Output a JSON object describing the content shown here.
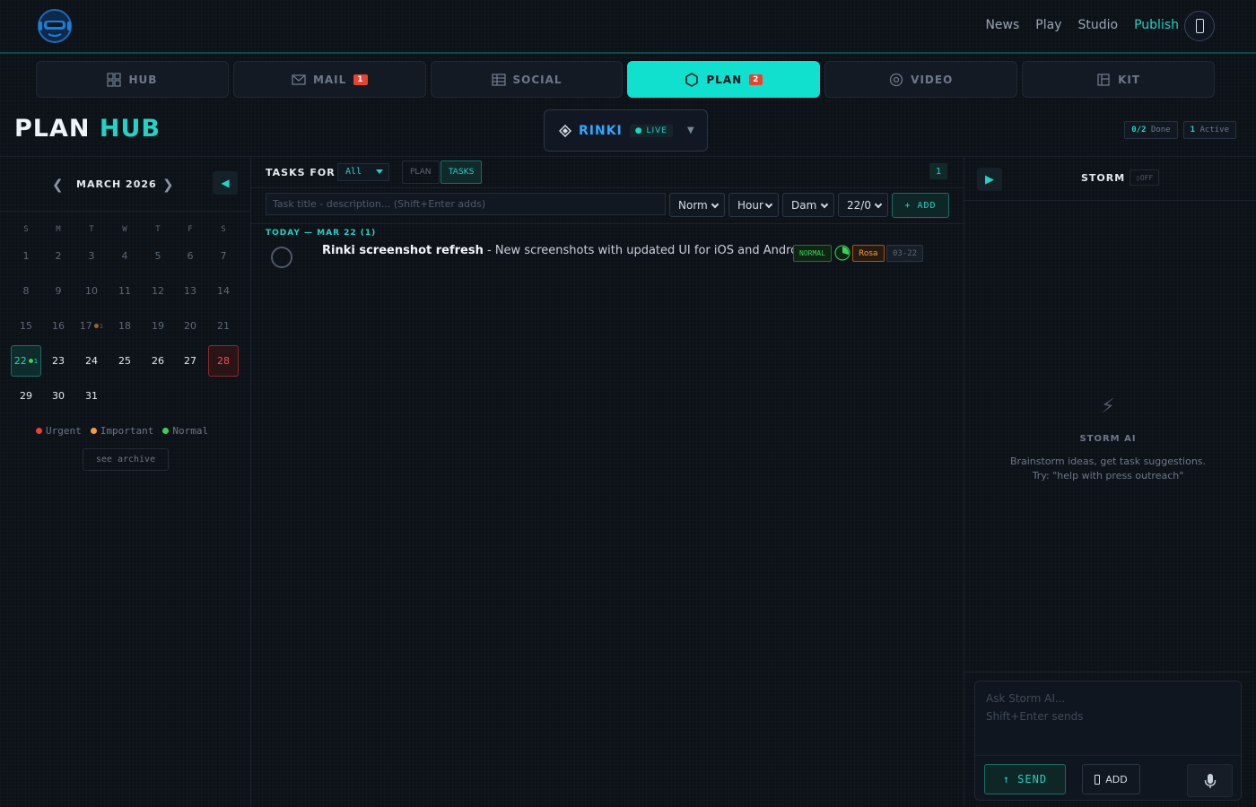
{
  "topnav": {
    "items": [
      {
        "label": "News",
        "active": false
      },
      {
        "label": "Play",
        "active": false
      },
      {
        "label": "Studio",
        "active": false
      },
      {
        "label": "Publish",
        "active": true
      }
    ]
  },
  "tabs": [
    {
      "label": "HUB",
      "icon": "grid-icon",
      "badge": ""
    },
    {
      "label": "MAIL",
      "icon": "mail-icon",
      "badge": "1"
    },
    {
      "label": "SOCIAL",
      "icon": "table-icon",
      "badge": ""
    },
    {
      "label": "PLAN",
      "icon": "hexagon-icon",
      "badge": "2",
      "active": true
    },
    {
      "label": "VIDEO",
      "icon": "target-icon",
      "badge": ""
    },
    {
      "label": "KIT",
      "icon": "kit-icon",
      "badge": ""
    }
  ],
  "header": {
    "title_part1": "PLAN",
    "title_part2": "HUB",
    "project": {
      "name": "RINKI",
      "status": "LIVE"
    },
    "stats": {
      "done_value": "0/2",
      "done_label": "Done",
      "active_value": "1",
      "active_label": "Active"
    }
  },
  "calendar": {
    "month_label": "MARCH 2026",
    "weekdays": [
      "S",
      "M",
      "T",
      "W",
      "T",
      "F",
      "S"
    ],
    "weeks": [
      [
        "1",
        "2",
        "3",
        "4",
        "5",
        "6",
        "7"
      ],
      [
        "8",
        "9",
        "10",
        "11",
        "12",
        "13",
        "14"
      ],
      [
        "15",
        "16",
        "17",
        "18",
        "19",
        "20",
        "21"
      ],
      [
        "22",
        "23",
        "24",
        "25",
        "26",
        "27",
        "28"
      ],
      [
        "29",
        "30",
        "31",
        "",
        "",
        "",
        ""
      ]
    ],
    "today": "22",
    "today_count": "1",
    "deadline_day": "28",
    "marked_day": "17",
    "marked_count": "1",
    "legend": [
      "Urgent",
      "Important",
      "Normal"
    ],
    "archive_label": "see archive",
    "colors": {
      "urgent": "#e8432f",
      "important": "#f39c3c",
      "normal": "#3ecf5a"
    }
  },
  "tasks": {
    "heading": "TASKS FOR",
    "filter_value": "All",
    "mode_plan": "PLAN",
    "mode_tasks": "TASKS",
    "count": "1",
    "input_placeholder": "Task title - description... (Shift+Enter adds)",
    "priority_value": "Norm",
    "unit_value": "Hour",
    "assignee_value": "Dam",
    "date_value": "22/0",
    "add_label": "+ ADD",
    "group_heading": "TODAY — MAR 22 (1)",
    "items": [
      {
        "title": "Rinki screenshot refresh",
        "description": " - New screenshots with updated UI for iOS and Android",
        "priority": "NORMAL",
        "progress_fraction": 0.3,
        "owner": "Rosa",
        "date": "03-22"
      }
    ]
  },
  "storm": {
    "title": "STORM",
    "state": "OFF",
    "empty_title": "STORM AI",
    "empty_line1": "Brainstorm ideas, get task suggestions.",
    "empty_line2": "Try: \"help with press outreach\"",
    "chat_placeholder": "Ask Storm AI...",
    "chat_hint": "Shift+Enter sends",
    "send_label": "SEND",
    "add_label": "ADD"
  },
  "accent_color": "#22d3c5"
}
